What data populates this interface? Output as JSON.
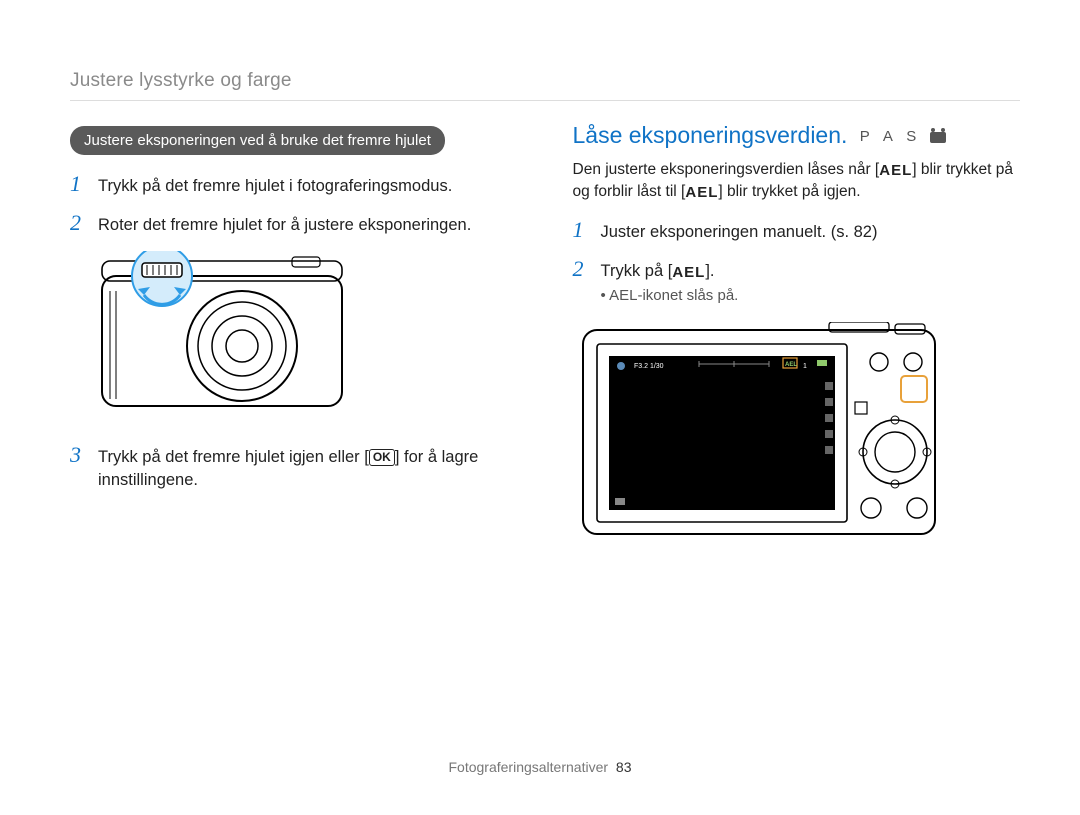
{
  "header": {
    "section_title": "Justere lysstyrke og farge"
  },
  "left": {
    "pill_label": "Justere eksponeringen ved å bruke det fremre hjulet",
    "steps": {
      "one": {
        "num": "1",
        "text": "Trykk på det fremre hjulet i fotograferingsmodus."
      },
      "two": {
        "num": "2",
        "text": "Roter det fremre hjulet for å justere eksponeringen."
      },
      "three": {
        "num": "3",
        "text_a": "Trykk på det fremre hjulet igjen eller [",
        "key": "OK",
        "text_b": "] for å lagre innstillingene."
      }
    }
  },
  "right": {
    "heading": "Låse eksponeringsverdien.",
    "modes": "P A S",
    "intro_a": "Den justerte eksponeringsverdien låses når [",
    "ael": "AEL",
    "intro_b": "] blir trykket på og forblir låst til [",
    "intro_c": "] blir trykket på igjen.",
    "steps": {
      "one": {
        "num": "1",
        "text": "Juster eksponeringen manuelt. (s. 82)"
      },
      "two": {
        "num": "2",
        "text_a": "Trykk på [",
        "text_b": "]."
      },
      "bullet": "AEL-ikonet slås på."
    },
    "screen": {
      "top": "F3.2 1/30",
      "one": "1"
    }
  },
  "footer": {
    "label": "Fotograferingsalternativer",
    "page": "83"
  }
}
